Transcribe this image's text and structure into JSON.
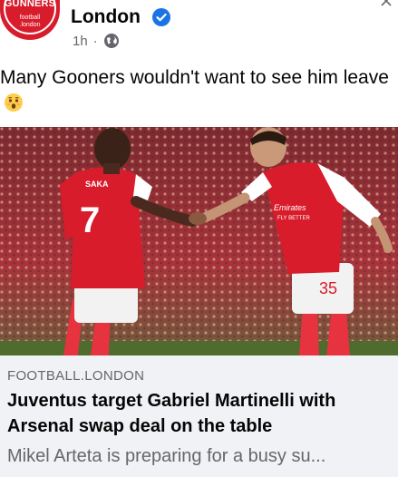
{
  "post": {
    "avatar": {
      "brand": "GUNNERS",
      "sub_line1": "football",
      "sub_line2": ".london"
    },
    "page_name": "London",
    "time": "1h",
    "separator": "·",
    "text": "Many Gooners wouldn't want to see him leave",
    "emoji": "astonished-face-emoji"
  },
  "photo": {
    "player_left": {
      "name": "SAKA",
      "number": "7"
    },
    "player_right": {
      "number": "35",
      "sponsor_line1": "Emirates",
      "sponsor_line2": "FLY BETTER"
    }
  },
  "link_preview": {
    "domain": "FOOTBALL.LONDON",
    "headline": "Juventus target Gabriel Martinelli with Arsenal swap deal on the table",
    "description": "Mikel Arteta is preparing for a busy su..."
  },
  "colors": {
    "arsenal_red": "#d81c2b",
    "verified_blue": "#1b74e4",
    "muted_text": "#65676b",
    "card_bg": "#f0f2f5"
  }
}
